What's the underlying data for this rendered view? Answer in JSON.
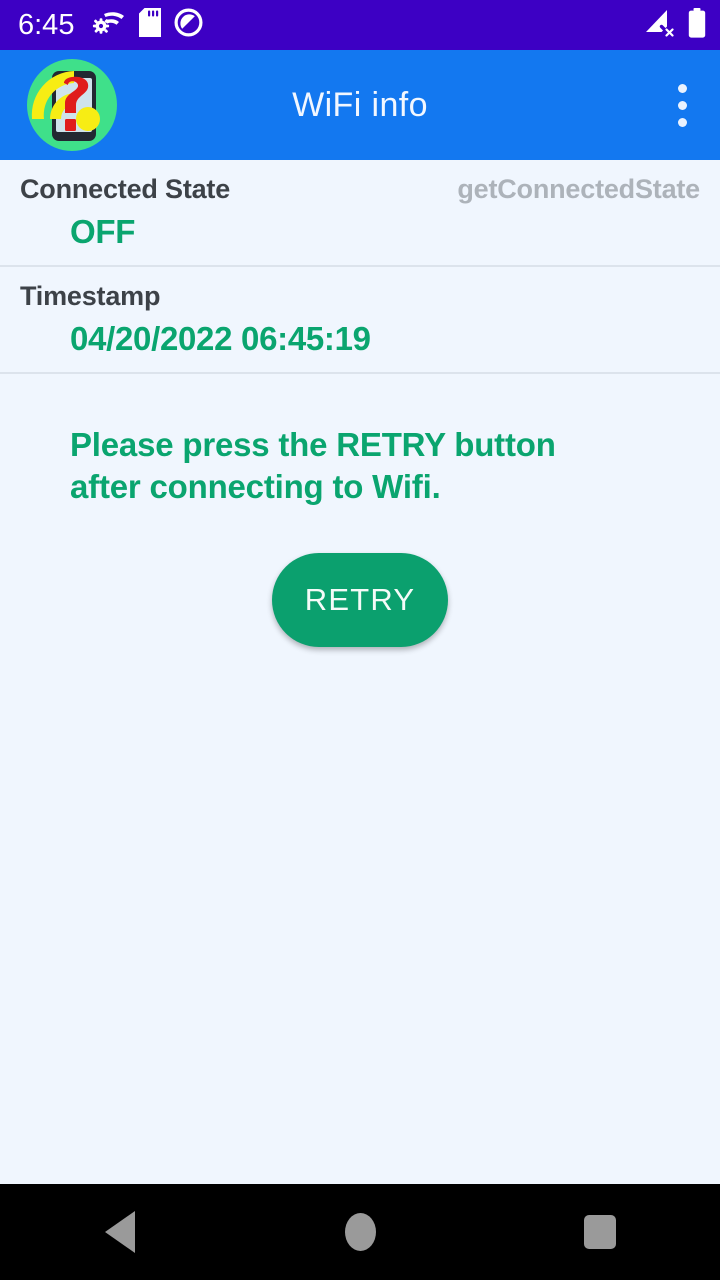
{
  "status_bar": {
    "clock": "6:45",
    "icons_left": [
      "settings-wifi-icon",
      "sd-card-icon",
      "do-not-disturb-icon"
    ],
    "icons_right": [
      "no-signal-icon",
      "battery-full-icon"
    ],
    "background_color": "#3D00C4"
  },
  "app_bar": {
    "title": "WiFi info",
    "logo": "wifi-question-app-logo",
    "overflow": "overflow-menu-icon",
    "background_color": "#1378F0"
  },
  "rows": [
    {
      "label": "Connected State",
      "method": "getConnectedState",
      "value": "OFF"
    },
    {
      "label": "Timestamp",
      "method": "",
      "value": "04/20/2022 06:45:19"
    }
  ],
  "message": "Please press the RETRY button after connecting to Wifi.",
  "retry_button": {
    "label": "RETRY",
    "color": "#0BA06E"
  },
  "nav_bar": {
    "back": "back-icon",
    "home": "home-icon",
    "recents": "recents-icon"
  },
  "colors": {
    "accent_green": "#0AA56F",
    "page_background": "#F0F6FE",
    "label_gray": "#3D4248",
    "method_gray": "#ADB3BA"
  }
}
